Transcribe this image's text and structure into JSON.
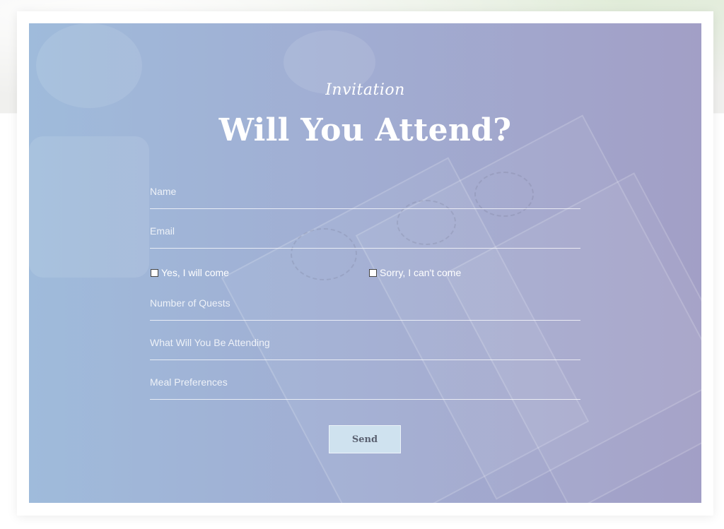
{
  "header": {
    "subtitle": "Invitation",
    "title": "Will You Attend?"
  },
  "form": {
    "name_placeholder": "Name",
    "email_placeholder": "Email",
    "attend_yes_label": "Yes, I will come",
    "attend_no_label": "Sorry, I can't come",
    "guests_placeholder": "Number of Quests",
    "attending_placeholder": "What Will You Be Attending",
    "meal_placeholder": "Meal Preferences",
    "send_label": "Send"
  },
  "colors": {
    "panel_gradient_start": "#9fbbdb",
    "panel_gradient_end": "#a29fc6",
    "button_bg": "#cfe2ef",
    "text": "#ffffff"
  }
}
